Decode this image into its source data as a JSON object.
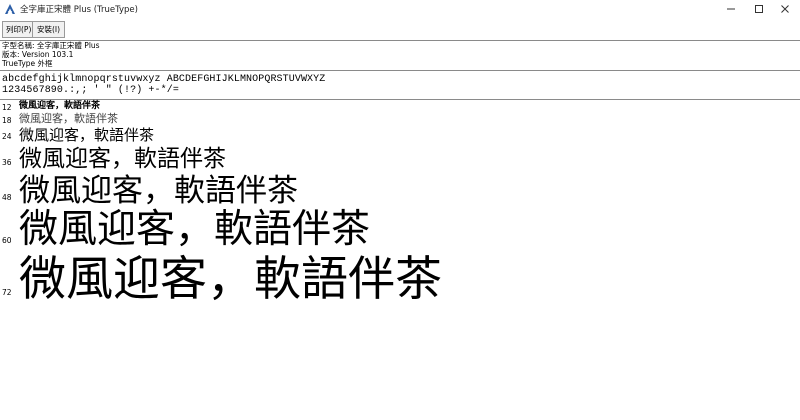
{
  "window": {
    "title": "全字庫正宋體 Plus (TrueType)",
    "icon": "font-app-icon",
    "controls": [
      "minimize",
      "maximize",
      "close"
    ]
  },
  "toolbar": {
    "print_label": "列印(P)",
    "install_label": "安裝(I)"
  },
  "font_info": {
    "name_line": "字型名稱: 全字庫正宋體 Plus",
    "version_line": "版本: Version 103.1",
    "type_line": "TrueType 外框"
  },
  "charset": {
    "line1": "abcdefghijklmnopqrstuvwxyz ABCDEFGHIJKLMNOPQRSTUVWXYZ",
    "line2": "1234567890.:,; ' \" (!?) +-*/="
  },
  "samples": [
    {
      "size": "12",
      "text": "微風迎客，軟語伴茶"
    },
    {
      "size": "18",
      "text": "微風迎客，軟語伴茶"
    },
    {
      "size": "24",
      "text": "微風迎客，軟語伴茶"
    },
    {
      "size": "36",
      "text": "微風迎客，軟語伴茶"
    },
    {
      "size": "48",
      "text": "微風迎客，軟語伴茶"
    },
    {
      "size": "60",
      "text": "微風迎客，軟語伴茶"
    },
    {
      "size": "72",
      "text": "微風迎客，軟語伴茶"
    }
  ]
}
